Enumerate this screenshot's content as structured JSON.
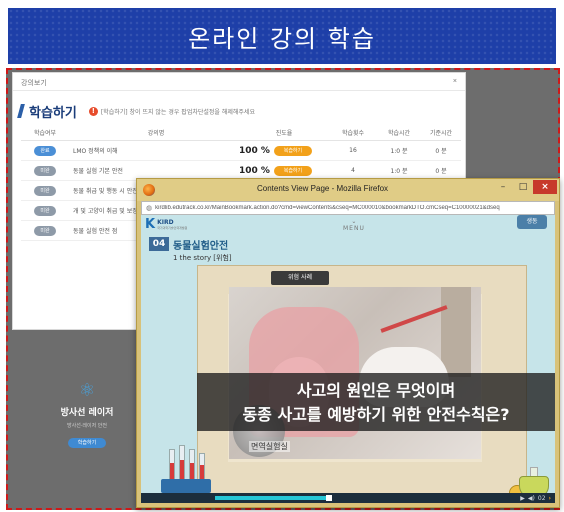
{
  "banner": {
    "title": "온라인 강의 학습"
  },
  "background_page": {
    "topbar_left": "강의보기",
    "topbar_right": "×",
    "title": "학습하기",
    "info_icon": "!",
    "info_text": "[학습하기] 창이 뜨지 않는 경우 팝업차단설정을 해제해주세요",
    "columns": [
      "학습여부",
      "강의명",
      "진도율",
      "학습횟수",
      "학습시간",
      "기준시간"
    ],
    "rows": [
      {
        "status": "완료",
        "title": "LMO 정책의 이해",
        "progress": "100 %",
        "button": "복습하기",
        "count": "16",
        "time": "1:0 분",
        "std": "0 분"
      },
      {
        "status": "미완",
        "title": "동물 실험 기본 안전",
        "progress": "100 %",
        "button": "복습하기",
        "count": "4",
        "time": "1:0 분",
        "std": "0 분"
      },
      {
        "status": "미완",
        "title": "동물 취급 및 행동 시 안전사항",
        "progress": "",
        "button": "",
        "count": "",
        "time": "",
        "std": ""
      },
      {
        "status": "미완",
        "title": "개 및 고양이 취급 및 보정",
        "progress": "",
        "button": "",
        "count": "",
        "time": "",
        "std": ""
      },
      {
        "status": "미완",
        "title": "동물 실험 안전 점",
        "progress": "",
        "button": "",
        "count": "",
        "time": "",
        "std": ""
      }
    ]
  },
  "side_item": {
    "icon": "atom-icon",
    "title": "방사선 레이저",
    "subtitle": "방사선·레이저 안전",
    "button": "학습하기"
  },
  "firefox": {
    "window_title": "Contents View Page - Mozilla Firefox",
    "controls": {
      "minimize": "–",
      "maximize": "□",
      "close": "×"
    },
    "url": "kirdlib.edutrack.co.kr/MainBookmark.action.do?cmd=viewContents&cseq=MC000010&bookmarkDTO.cmCseq=C10000021&dseq"
  },
  "content": {
    "logo_letter": "K",
    "logo_name": "KIRD",
    "logo_sub": "국가과학기술인력개발원",
    "menu_label": "MENU",
    "view_mode_button": "생동",
    "chapter_number": "04",
    "chapter_title": "동물실험안전",
    "chapter_sub": "1 the story [위험]",
    "case_tag": "위험 사례",
    "subtitle_line1": "사고의 원인은 무엇이며",
    "subtitle_line2": "동종 사고를 예방하기 위한 안전수칙은?",
    "cell_label": "면역실험실",
    "player": {
      "progress_fraction": 0.38,
      "page": "02",
      "next": "›"
    }
  },
  "colors": {
    "banner": "#1e3fa8",
    "frame_border": "#d01818",
    "accent_orange": "#f2a11a",
    "accent_blue": "#3f8ad2"
  }
}
